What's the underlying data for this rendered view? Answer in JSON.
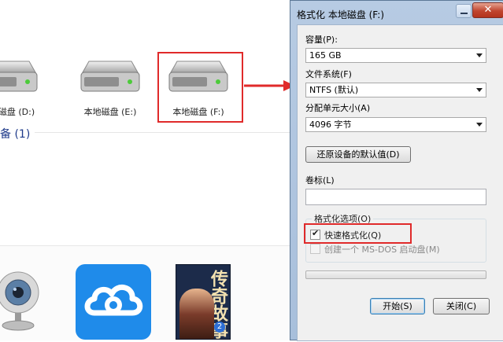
{
  "explorer": {
    "drives": [
      {
        "label": "本地磁盘 (D:)"
      },
      {
        "label": "本地磁盘 (E:)"
      },
      {
        "label": "本地磁盘 (F:)"
      }
    ],
    "section_title": "备 (1)",
    "book": {
      "title": "传奇故事",
      "number": "2"
    }
  },
  "dialog": {
    "title": "格式化 本地磁盘 (F:)",
    "close_glyph": "✕",
    "capacity_label": "容量(P):",
    "capacity_value": "165 GB",
    "filesystem_label": "文件系统(F)",
    "filesystem_value": "NTFS (默认)",
    "allocation_label": "分配单元大小(A)",
    "allocation_value": "4096 字节",
    "restore_button": "还原设备的默认值(D)",
    "volume_label": "卷标(L)",
    "volume_value": "",
    "options_legend": "格式化选项(O)",
    "quick_format_label": "快速格式化(Q)",
    "quick_format_checked": true,
    "msdos_label": "创建一个 MS-DOS 启动盘(M)",
    "msdos_checked": false,
    "progress": 0,
    "start_button": "开始(S)",
    "close_button": "关闭(C)"
  },
  "colors": {
    "highlight": "#e02a2a",
    "title_close": "#c0452f",
    "dialog_frame": "#b7cbe3",
    "cloud_tile": "#1f8bea"
  }
}
